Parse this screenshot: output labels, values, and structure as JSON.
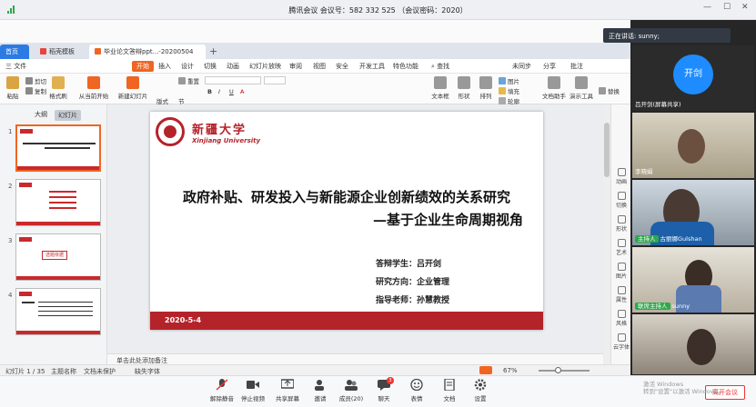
{
  "meeting": {
    "title": "腾讯会议 会议号：582 332 525  （会议密码：2020）",
    "speaking": "正在讲话: sunny;"
  },
  "wps": {
    "tabs": [
      "首页",
      "稻壳模板",
      "毕业论文答辩ppt...-20200504"
    ],
    "menu": [
      "三 文件",
      "开始",
      "插入",
      "设计",
      "切换",
      "动画",
      "幻灯片放映",
      "审阅",
      "视图",
      "安全",
      "开发工具",
      "特色功能",
      "查找",
      "未同步",
      "分享",
      "批注"
    ],
    "ribbon": {
      "paste": "粘贴",
      "cut": "剪切",
      "copy": "复制",
      "format": "格式刷",
      "from_current": "从当前开始",
      "new_slide": "新建幻灯片",
      "layout": "版式",
      "section": "节",
      "reset": "重置",
      "textbox": "文本框",
      "shape": "形状",
      "arrange": "排列",
      "picture": "图片",
      "fill": "填充",
      "outline": "轮廓",
      "doc_assistant": "文档助手",
      "presenter": "演示工具",
      "replace": "替换"
    },
    "pane_tabs": [
      "大纲",
      "幻灯片"
    ],
    "add_slide": "+",
    "notes_placeholder": "单击此处添加备注",
    "right_tools": [
      "动画",
      "切换",
      "形状",
      "艺术",
      "图片",
      "属性",
      "风格",
      "云字体"
    ],
    "status": {
      "slide": "幻灯片 1 / 35",
      "theme": "主题名称",
      "protect": "文档未保护",
      "font": "缺失字体",
      "zoom": "67%"
    }
  },
  "slide": {
    "university_cn": "新疆大学",
    "university_en": "Xinjiang University",
    "title": "政府补贴、研发投入与新能源企业创新绩效的关系研究",
    "subtitle": "—基于企业生命周期视角",
    "student": "答辩学生：吕开剑",
    "major": "研究方向：企业管理",
    "advisor": "指导老师：孙慧教授",
    "date": "2020-5-4"
  },
  "participants": [
    {
      "name": "吕开剑(屏幕共享)",
      "avatar_text": "开剑"
    },
    {
      "name": "李晓娟"
    },
    {
      "role": "主持人",
      "name": "古丽娜Gulshan"
    },
    {
      "role": "联席主持人",
      "name": "sunny"
    },
    {
      "name": ""
    }
  ],
  "toolbar": {
    "mute": "解除静音",
    "video": "停止视频",
    "share": "共享屏幕",
    "invite": "邀请",
    "members": "成员(20)",
    "chat": "聊天",
    "chat_badge": "3",
    "emoji": "表情",
    "docs": "文档",
    "settings": "设置",
    "leave": "离开会议"
  },
  "watermark": {
    "line1": "激活 Windows",
    "line2": "转到\"设置\"以激活 Windows。"
  },
  "colors": {
    "accent": "#f06522",
    "brand_red": "#b5232a",
    "meeting_blue": "#1e8cff",
    "host_green": "#2ea84d"
  }
}
